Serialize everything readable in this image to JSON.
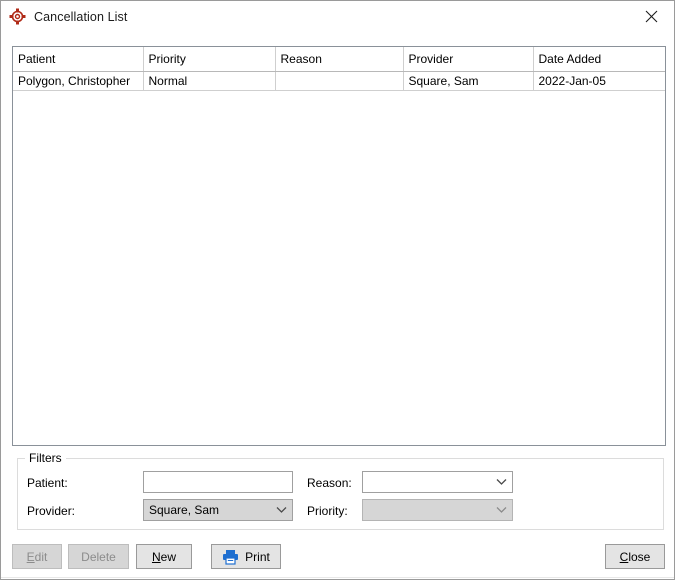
{
  "window": {
    "title": "Cancellation List",
    "icon": "target-crosshair-icon",
    "close_label": "✕",
    "accent_red": "#b02a17",
    "accent_blue": "#1f6fd0"
  },
  "grid": {
    "columns": [
      "Patient",
      "Priority",
      "Reason",
      "Provider",
      "Date Added"
    ],
    "rows": [
      {
        "patient": "Polygon, Christopher",
        "priority": "Normal",
        "reason": "",
        "provider": "Square, Sam",
        "date_added": "2022-Jan-05"
      }
    ]
  },
  "filters": {
    "legend": "Filters",
    "patient": {
      "label": "Patient:",
      "value": "",
      "placeholder": ""
    },
    "provider": {
      "label": "Provider:",
      "value": "Square, Sam"
    },
    "reason": {
      "label": "Reason:",
      "value": ""
    },
    "priority": {
      "label": "Priority:",
      "value": ""
    }
  },
  "buttons": {
    "edit": {
      "label": "Edit",
      "accel": "E",
      "rest": "dit",
      "enabled": false
    },
    "delete": {
      "label": "Delete",
      "enabled": false
    },
    "new": {
      "label": "New",
      "accel": "N",
      "rest": "ew",
      "enabled": true
    },
    "print": {
      "label": "Print",
      "icon": "printer-icon",
      "enabled": true
    },
    "close": {
      "label": "Close",
      "accel": "C",
      "rest": "lose",
      "enabled": true
    }
  }
}
